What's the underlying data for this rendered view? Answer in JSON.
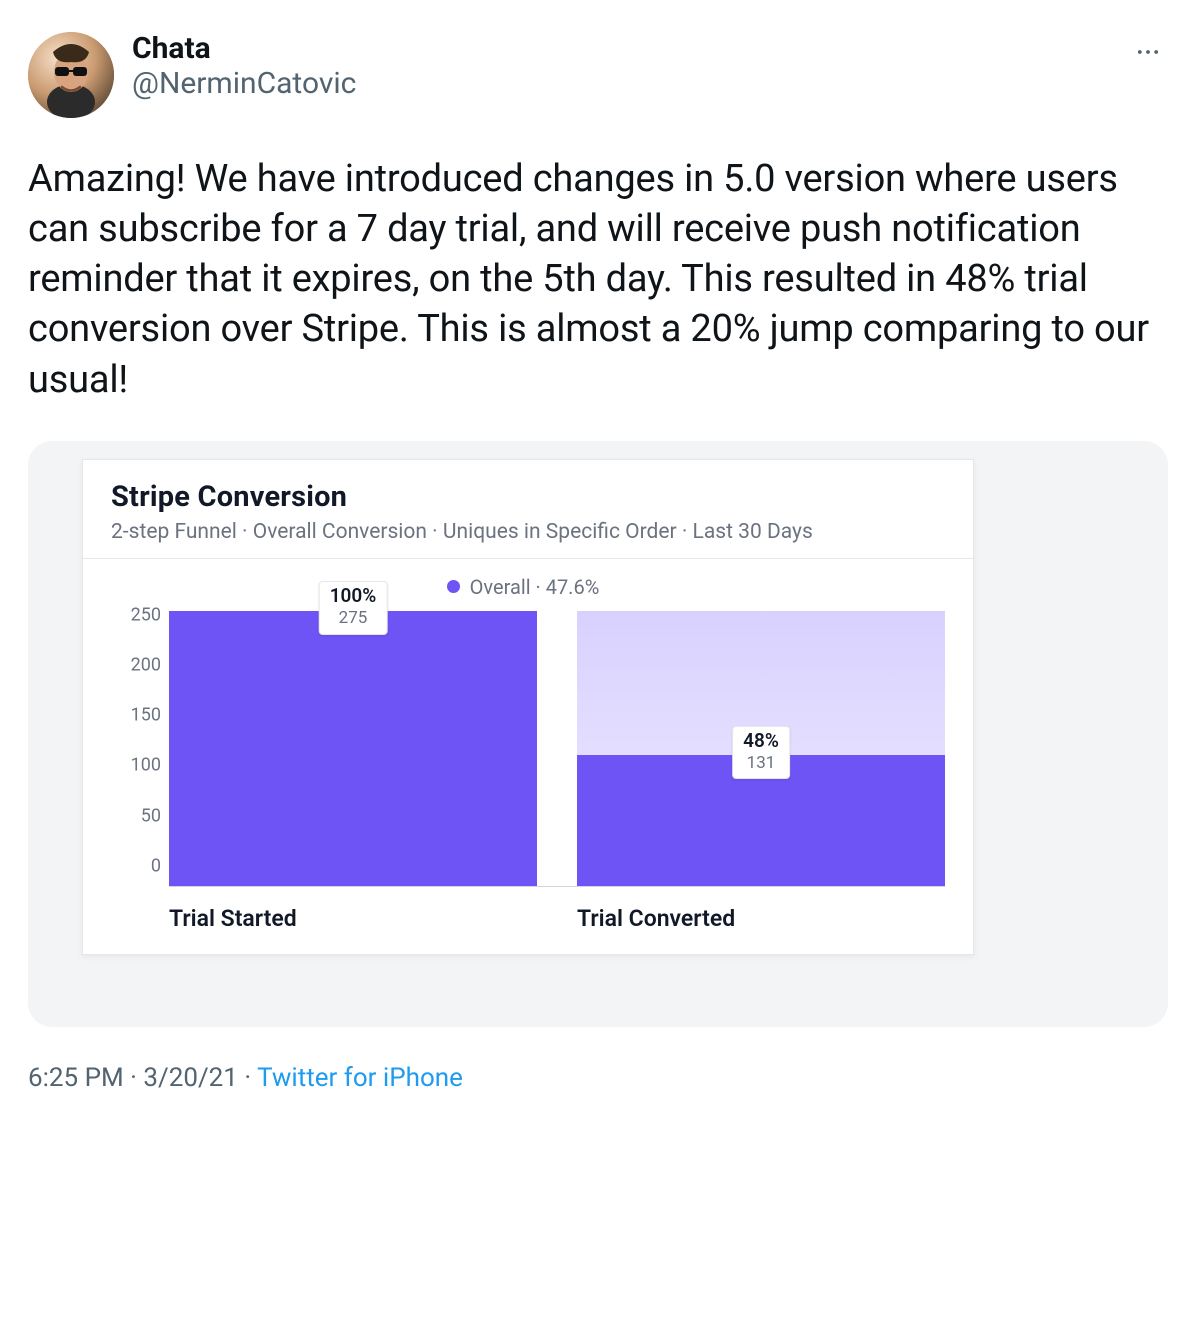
{
  "tweet": {
    "display_name": "Chata",
    "handle": "@NerminCatovic",
    "body": "Amazing! We have introduced changes in 5.0 version where users can subscribe for a 7 day trial, and will receive push notification reminder that it expires, on the 5th day. This resulted in 48% trial conversion over Stripe. This is almost a 20% jump comparing to our usual!",
    "timestamp": "6:25 PM · 3/20/21",
    "source": "Twitter for iPhone"
  },
  "chart_card": {
    "title": "Stripe Conversion",
    "subtitle": "2-step Funnel · Overall Conversion · Uniques in Specific Order · Last 30 Days",
    "legend": "Overall · 47.6%"
  },
  "chart_data": {
    "type": "bar",
    "title": "Stripe Conversion",
    "subtitle": "2-step Funnel · Overall Conversion · Uniques in Specific Order · Last 30 Days",
    "legend": "Overall · 47.6%",
    "categories": [
      "Trial Started",
      "Trial Converted"
    ],
    "values": [
      275,
      131
    ],
    "percent_labels": [
      "100%",
      "48%"
    ],
    "ylim": [
      0,
      275
    ],
    "y_ticks": [
      0,
      50,
      100,
      150,
      200,
      250
    ],
    "colors": {
      "fill": "#6E53F5",
      "background": "#D8D1FF"
    }
  }
}
